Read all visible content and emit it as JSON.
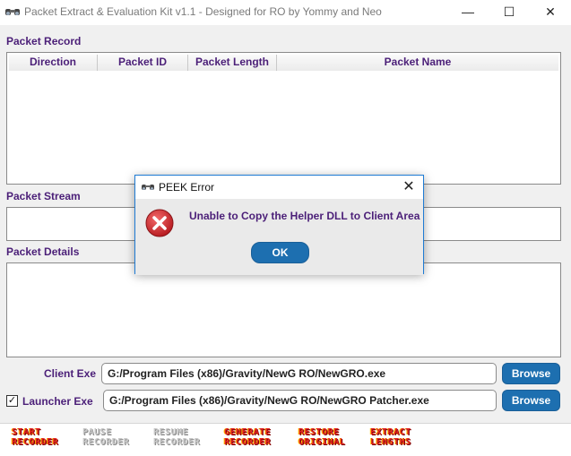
{
  "window": {
    "title": "Packet Extract & Evaluation Kit v1.1 - Designed for RO by Yommy and Neo",
    "minimize_glyph": "—",
    "maximize_glyph": "☐",
    "close_glyph": "✕"
  },
  "packet_record": {
    "label": "Packet Record",
    "columns": [
      "Direction",
      "Packet ID",
      "Packet Length",
      "Packet Name"
    ]
  },
  "packet_stream": {
    "label": "Packet Stream"
  },
  "packet_details": {
    "label": "Packet Details"
  },
  "client_exe": {
    "label": "Client Exe",
    "value": "G:/Program Files (x86)/Gravity/NewG RO/NewGRO.exe",
    "browse_label": "Browse"
  },
  "launcher_exe": {
    "label": "Launcher Exe",
    "checked": true,
    "check_glyph": "✓",
    "value": "G:/Program Files (x86)/Gravity/NewG RO/NewGRO Patcher.exe",
    "browse_label": "Browse"
  },
  "recorder_buttons": [
    {
      "line1": "START",
      "line2": "RECORDER",
      "enabled": true
    },
    {
      "line1": "PAUSE",
      "line2": "RECORDER",
      "enabled": false
    },
    {
      "line1": "RESUME",
      "line2": "RECORDER",
      "enabled": false
    },
    {
      "line1": "GENERATE",
      "line2": "RECORDER",
      "enabled": true
    },
    {
      "line1": "RESTORE",
      "line2": "ORIGINAL",
      "enabled": true
    },
    {
      "line1": "EXTRACT",
      "line2": "LENGTHS",
      "enabled": true
    }
  ],
  "dialog": {
    "title": "PEEK Error",
    "close_glyph": "✕",
    "message": "Unable to Copy the Helper DLL to Client Area",
    "ok_label": "OK"
  },
  "colors": {
    "label_purple": "#4b1f78",
    "button_blue": "#1d6fb0",
    "error_red": "#d9262b"
  },
  "icons": {
    "app": "binoculars-icon",
    "dialog_app": "binoculars-icon",
    "error": "error-x-icon"
  }
}
